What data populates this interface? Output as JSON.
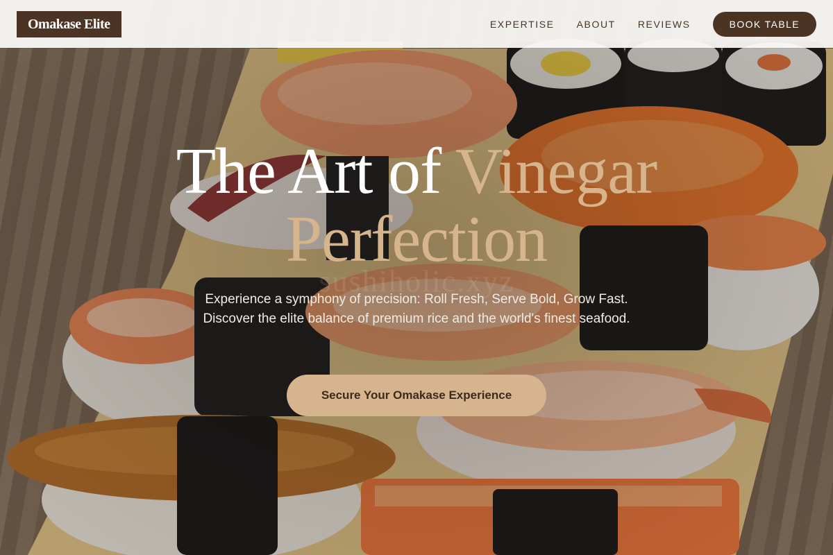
{
  "header": {
    "logo": "Omakase Elite",
    "nav": [
      "EXPERTISE",
      "ABOUT",
      "REVIEWS"
    ],
    "cta": "BOOK TABLE"
  },
  "hero": {
    "title_main": "The Art of ",
    "title_accent_1": "Vinegar",
    "title_accent_2": "Perfection",
    "watermark": "sushiholic.xyz",
    "subtitle": "Experience a symphony of precision: Roll Fresh, Serve Bold, Grow Fast. Discover the elite balance of premium rice and the world's finest seafood.",
    "cta": "Secure Your Omakase Experience"
  },
  "colors": {
    "brand_dark": "#4b3424",
    "accent_gold": "#d6b48c",
    "nav_bg": "#faf9f7"
  }
}
